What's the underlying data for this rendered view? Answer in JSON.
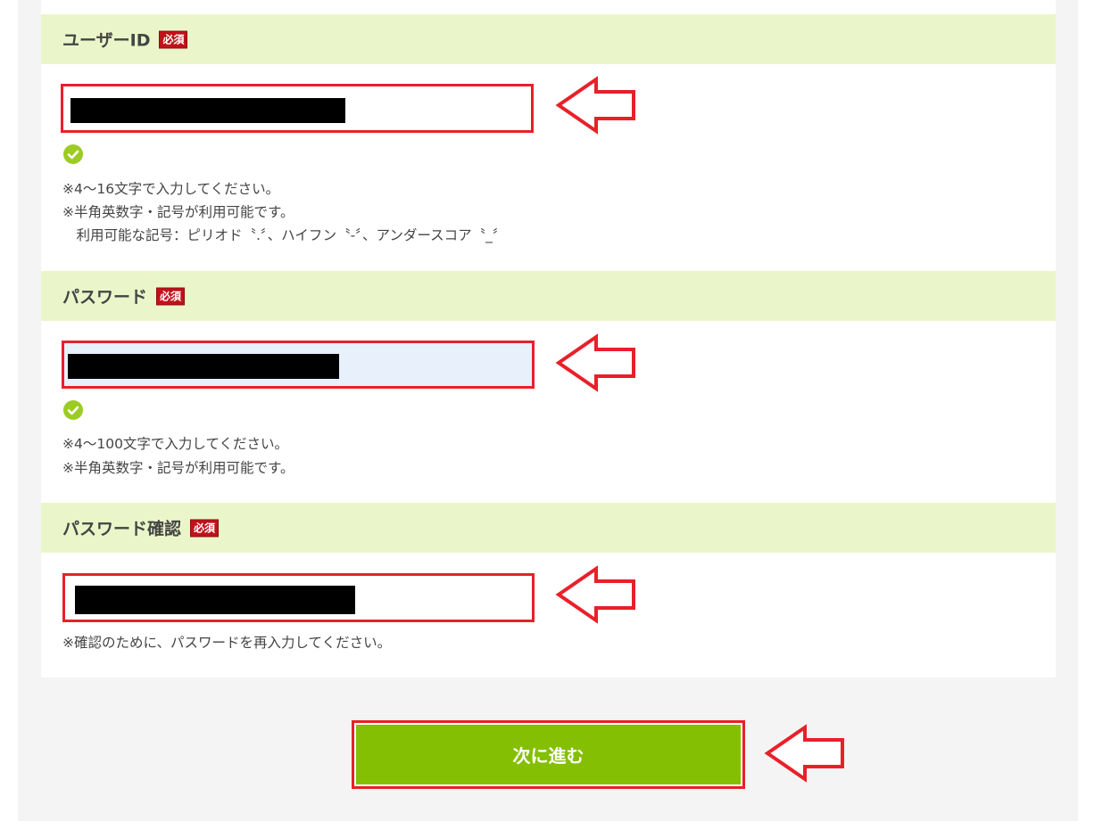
{
  "required_label": "必須",
  "user_id": {
    "label": "ユーザーID",
    "notes": [
      "※4～16文字で入力してください。",
      "※半角英数字・記号が利用可能です。",
      "　利用可能な記号：ピリオド〝.〞、ハイフン〝-〞、アンダースコア〝_〞"
    ]
  },
  "password": {
    "label": "パスワード",
    "notes": [
      "※4～100文字で入力してください。",
      "※半角英数字・記号が利用可能です。"
    ]
  },
  "password_confirm": {
    "label": "パスワード確認",
    "notes": [
      "※確認のために、パスワードを再入力してください。"
    ]
  },
  "submit": {
    "label": "次に進む"
  },
  "colors": {
    "header_bg": "#eaf6c9",
    "required_badge": "#c1121a",
    "highlight_red": "#e8202a",
    "button_green": "#84bf04",
    "check_green": "#9ccc23"
  },
  "icons": {
    "valid": "check-circle-icon",
    "pointer": "arrow-left-outline-icon"
  }
}
